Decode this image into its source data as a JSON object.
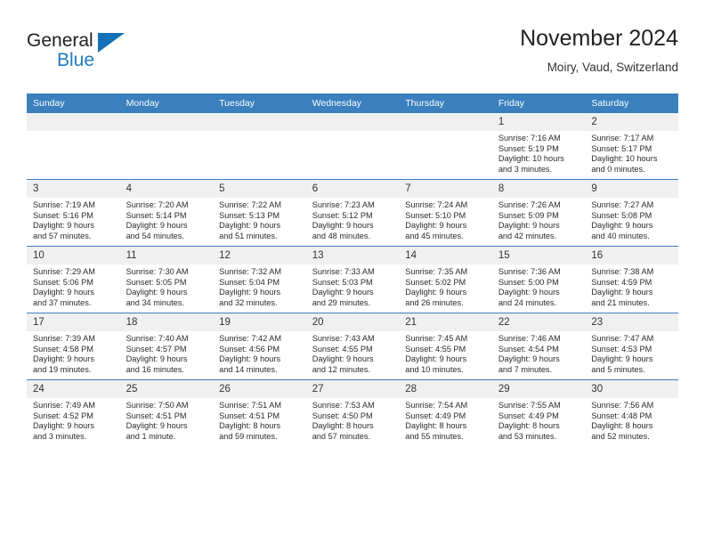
{
  "logo": {
    "word_top": "General",
    "word_bottom": "Blue",
    "triangle_color": "#1271b8",
    "blue_color": "#1f7bc1"
  },
  "header": {
    "title": "November 2024",
    "subtitle": "Moiry, Vaud, Switzerland"
  },
  "theme": {
    "header_blue": "#3a7fbe",
    "daynum_band": "#f0f0f0",
    "text": "#2b2b2b"
  },
  "weekdays": [
    "Sunday",
    "Monday",
    "Tuesday",
    "Wednesday",
    "Thursday",
    "Friday",
    "Saturday"
  ],
  "weeks": [
    [
      {
        "day": "",
        "empty": true
      },
      {
        "day": "",
        "empty": true
      },
      {
        "day": "",
        "empty": true
      },
      {
        "day": "",
        "empty": true
      },
      {
        "day": "",
        "empty": true
      },
      {
        "day": "1",
        "sunrise": "Sunrise: 7:16 AM",
        "sunset": "Sunset: 5:19 PM",
        "daylight1": "Daylight: 10 hours",
        "daylight2": "and 3 minutes."
      },
      {
        "day": "2",
        "sunrise": "Sunrise: 7:17 AM",
        "sunset": "Sunset: 5:17 PM",
        "daylight1": "Daylight: 10 hours",
        "daylight2": "and 0 minutes."
      }
    ],
    [
      {
        "day": "3",
        "sunrise": "Sunrise: 7:19 AM",
        "sunset": "Sunset: 5:16 PM",
        "daylight1": "Daylight: 9 hours",
        "daylight2": "and 57 minutes."
      },
      {
        "day": "4",
        "sunrise": "Sunrise: 7:20 AM",
        "sunset": "Sunset: 5:14 PM",
        "daylight1": "Daylight: 9 hours",
        "daylight2": "and 54 minutes."
      },
      {
        "day": "5",
        "sunrise": "Sunrise: 7:22 AM",
        "sunset": "Sunset: 5:13 PM",
        "daylight1": "Daylight: 9 hours",
        "daylight2": "and 51 minutes."
      },
      {
        "day": "6",
        "sunrise": "Sunrise: 7:23 AM",
        "sunset": "Sunset: 5:12 PM",
        "daylight1": "Daylight: 9 hours",
        "daylight2": "and 48 minutes."
      },
      {
        "day": "7",
        "sunrise": "Sunrise: 7:24 AM",
        "sunset": "Sunset: 5:10 PM",
        "daylight1": "Daylight: 9 hours",
        "daylight2": "and 45 minutes."
      },
      {
        "day": "8",
        "sunrise": "Sunrise: 7:26 AM",
        "sunset": "Sunset: 5:09 PM",
        "daylight1": "Daylight: 9 hours",
        "daylight2": "and 42 minutes."
      },
      {
        "day": "9",
        "sunrise": "Sunrise: 7:27 AM",
        "sunset": "Sunset: 5:08 PM",
        "daylight1": "Daylight: 9 hours",
        "daylight2": "and 40 minutes."
      }
    ],
    [
      {
        "day": "10",
        "sunrise": "Sunrise: 7:29 AM",
        "sunset": "Sunset: 5:06 PM",
        "daylight1": "Daylight: 9 hours",
        "daylight2": "and 37 minutes."
      },
      {
        "day": "11",
        "sunrise": "Sunrise: 7:30 AM",
        "sunset": "Sunset: 5:05 PM",
        "daylight1": "Daylight: 9 hours",
        "daylight2": "and 34 minutes."
      },
      {
        "day": "12",
        "sunrise": "Sunrise: 7:32 AM",
        "sunset": "Sunset: 5:04 PM",
        "daylight1": "Daylight: 9 hours",
        "daylight2": "and 32 minutes."
      },
      {
        "day": "13",
        "sunrise": "Sunrise: 7:33 AM",
        "sunset": "Sunset: 5:03 PM",
        "daylight1": "Daylight: 9 hours",
        "daylight2": "and 29 minutes."
      },
      {
        "day": "14",
        "sunrise": "Sunrise: 7:35 AM",
        "sunset": "Sunset: 5:02 PM",
        "daylight1": "Daylight: 9 hours",
        "daylight2": "and 26 minutes."
      },
      {
        "day": "15",
        "sunrise": "Sunrise: 7:36 AM",
        "sunset": "Sunset: 5:00 PM",
        "daylight1": "Daylight: 9 hours",
        "daylight2": "and 24 minutes."
      },
      {
        "day": "16",
        "sunrise": "Sunrise: 7:38 AM",
        "sunset": "Sunset: 4:59 PM",
        "daylight1": "Daylight: 9 hours",
        "daylight2": "and 21 minutes."
      }
    ],
    [
      {
        "day": "17",
        "sunrise": "Sunrise: 7:39 AM",
        "sunset": "Sunset: 4:58 PM",
        "daylight1": "Daylight: 9 hours",
        "daylight2": "and 19 minutes."
      },
      {
        "day": "18",
        "sunrise": "Sunrise: 7:40 AM",
        "sunset": "Sunset: 4:57 PM",
        "daylight1": "Daylight: 9 hours",
        "daylight2": "and 16 minutes."
      },
      {
        "day": "19",
        "sunrise": "Sunrise: 7:42 AM",
        "sunset": "Sunset: 4:56 PM",
        "daylight1": "Daylight: 9 hours",
        "daylight2": "and 14 minutes."
      },
      {
        "day": "20",
        "sunrise": "Sunrise: 7:43 AM",
        "sunset": "Sunset: 4:55 PM",
        "daylight1": "Daylight: 9 hours",
        "daylight2": "and 12 minutes."
      },
      {
        "day": "21",
        "sunrise": "Sunrise: 7:45 AM",
        "sunset": "Sunset: 4:55 PM",
        "daylight1": "Daylight: 9 hours",
        "daylight2": "and 10 minutes."
      },
      {
        "day": "22",
        "sunrise": "Sunrise: 7:46 AM",
        "sunset": "Sunset: 4:54 PM",
        "daylight1": "Daylight: 9 hours",
        "daylight2": "and 7 minutes."
      },
      {
        "day": "23",
        "sunrise": "Sunrise: 7:47 AM",
        "sunset": "Sunset: 4:53 PM",
        "daylight1": "Daylight: 9 hours",
        "daylight2": "and 5 minutes."
      }
    ],
    [
      {
        "day": "24",
        "sunrise": "Sunrise: 7:49 AM",
        "sunset": "Sunset: 4:52 PM",
        "daylight1": "Daylight: 9 hours",
        "daylight2": "and 3 minutes."
      },
      {
        "day": "25",
        "sunrise": "Sunrise: 7:50 AM",
        "sunset": "Sunset: 4:51 PM",
        "daylight1": "Daylight: 9 hours",
        "daylight2": "and 1 minute."
      },
      {
        "day": "26",
        "sunrise": "Sunrise: 7:51 AM",
        "sunset": "Sunset: 4:51 PM",
        "daylight1": "Daylight: 8 hours",
        "daylight2": "and 59 minutes."
      },
      {
        "day": "27",
        "sunrise": "Sunrise: 7:53 AM",
        "sunset": "Sunset: 4:50 PM",
        "daylight1": "Daylight: 8 hours",
        "daylight2": "and 57 minutes."
      },
      {
        "day": "28",
        "sunrise": "Sunrise: 7:54 AM",
        "sunset": "Sunset: 4:49 PM",
        "daylight1": "Daylight: 8 hours",
        "daylight2": "and 55 minutes."
      },
      {
        "day": "29",
        "sunrise": "Sunrise: 7:55 AM",
        "sunset": "Sunset: 4:49 PM",
        "daylight1": "Daylight: 8 hours",
        "daylight2": "and 53 minutes."
      },
      {
        "day": "30",
        "sunrise": "Sunrise: 7:56 AM",
        "sunset": "Sunset: 4:48 PM",
        "daylight1": "Daylight: 8 hours",
        "daylight2": "and 52 minutes."
      }
    ]
  ]
}
